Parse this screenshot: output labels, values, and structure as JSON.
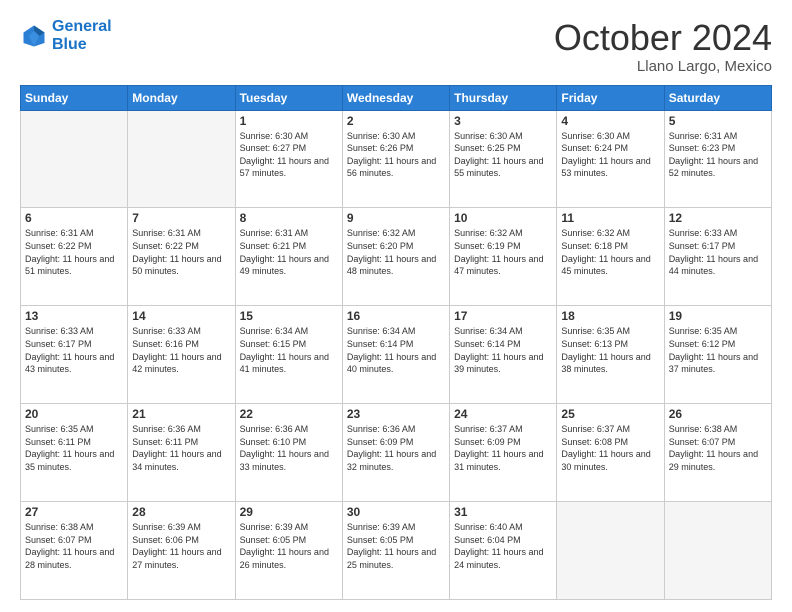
{
  "logo": {
    "line1": "General",
    "line2": "Blue"
  },
  "header": {
    "month": "October 2024",
    "location": "Llano Largo, Mexico"
  },
  "weekdays": [
    "Sunday",
    "Monday",
    "Tuesday",
    "Wednesday",
    "Thursday",
    "Friday",
    "Saturday"
  ],
  "weeks": [
    [
      {
        "day": "",
        "info": ""
      },
      {
        "day": "",
        "info": ""
      },
      {
        "day": "1",
        "info": "Sunrise: 6:30 AM\nSunset: 6:27 PM\nDaylight: 11 hours and 57 minutes."
      },
      {
        "day": "2",
        "info": "Sunrise: 6:30 AM\nSunset: 6:26 PM\nDaylight: 11 hours and 56 minutes."
      },
      {
        "day": "3",
        "info": "Sunrise: 6:30 AM\nSunset: 6:25 PM\nDaylight: 11 hours and 55 minutes."
      },
      {
        "day": "4",
        "info": "Sunrise: 6:30 AM\nSunset: 6:24 PM\nDaylight: 11 hours and 53 minutes."
      },
      {
        "day": "5",
        "info": "Sunrise: 6:31 AM\nSunset: 6:23 PM\nDaylight: 11 hours and 52 minutes."
      }
    ],
    [
      {
        "day": "6",
        "info": "Sunrise: 6:31 AM\nSunset: 6:22 PM\nDaylight: 11 hours and 51 minutes."
      },
      {
        "day": "7",
        "info": "Sunrise: 6:31 AM\nSunset: 6:22 PM\nDaylight: 11 hours and 50 minutes."
      },
      {
        "day": "8",
        "info": "Sunrise: 6:31 AM\nSunset: 6:21 PM\nDaylight: 11 hours and 49 minutes."
      },
      {
        "day": "9",
        "info": "Sunrise: 6:32 AM\nSunset: 6:20 PM\nDaylight: 11 hours and 48 minutes."
      },
      {
        "day": "10",
        "info": "Sunrise: 6:32 AM\nSunset: 6:19 PM\nDaylight: 11 hours and 47 minutes."
      },
      {
        "day": "11",
        "info": "Sunrise: 6:32 AM\nSunset: 6:18 PM\nDaylight: 11 hours and 45 minutes."
      },
      {
        "day": "12",
        "info": "Sunrise: 6:33 AM\nSunset: 6:17 PM\nDaylight: 11 hours and 44 minutes."
      }
    ],
    [
      {
        "day": "13",
        "info": "Sunrise: 6:33 AM\nSunset: 6:17 PM\nDaylight: 11 hours and 43 minutes."
      },
      {
        "day": "14",
        "info": "Sunrise: 6:33 AM\nSunset: 6:16 PM\nDaylight: 11 hours and 42 minutes."
      },
      {
        "day": "15",
        "info": "Sunrise: 6:34 AM\nSunset: 6:15 PM\nDaylight: 11 hours and 41 minutes."
      },
      {
        "day": "16",
        "info": "Sunrise: 6:34 AM\nSunset: 6:14 PM\nDaylight: 11 hours and 40 minutes."
      },
      {
        "day": "17",
        "info": "Sunrise: 6:34 AM\nSunset: 6:14 PM\nDaylight: 11 hours and 39 minutes."
      },
      {
        "day": "18",
        "info": "Sunrise: 6:35 AM\nSunset: 6:13 PM\nDaylight: 11 hours and 38 minutes."
      },
      {
        "day": "19",
        "info": "Sunrise: 6:35 AM\nSunset: 6:12 PM\nDaylight: 11 hours and 37 minutes."
      }
    ],
    [
      {
        "day": "20",
        "info": "Sunrise: 6:35 AM\nSunset: 6:11 PM\nDaylight: 11 hours and 35 minutes."
      },
      {
        "day": "21",
        "info": "Sunrise: 6:36 AM\nSunset: 6:11 PM\nDaylight: 11 hours and 34 minutes."
      },
      {
        "day": "22",
        "info": "Sunrise: 6:36 AM\nSunset: 6:10 PM\nDaylight: 11 hours and 33 minutes."
      },
      {
        "day": "23",
        "info": "Sunrise: 6:36 AM\nSunset: 6:09 PM\nDaylight: 11 hours and 32 minutes."
      },
      {
        "day": "24",
        "info": "Sunrise: 6:37 AM\nSunset: 6:09 PM\nDaylight: 11 hours and 31 minutes."
      },
      {
        "day": "25",
        "info": "Sunrise: 6:37 AM\nSunset: 6:08 PM\nDaylight: 11 hours and 30 minutes."
      },
      {
        "day": "26",
        "info": "Sunrise: 6:38 AM\nSunset: 6:07 PM\nDaylight: 11 hours and 29 minutes."
      }
    ],
    [
      {
        "day": "27",
        "info": "Sunrise: 6:38 AM\nSunset: 6:07 PM\nDaylight: 11 hours and 28 minutes."
      },
      {
        "day": "28",
        "info": "Sunrise: 6:39 AM\nSunset: 6:06 PM\nDaylight: 11 hours and 27 minutes."
      },
      {
        "day": "29",
        "info": "Sunrise: 6:39 AM\nSunset: 6:05 PM\nDaylight: 11 hours and 26 minutes."
      },
      {
        "day": "30",
        "info": "Sunrise: 6:39 AM\nSunset: 6:05 PM\nDaylight: 11 hours and 25 minutes."
      },
      {
        "day": "31",
        "info": "Sunrise: 6:40 AM\nSunset: 6:04 PM\nDaylight: 11 hours and 24 minutes."
      },
      {
        "day": "",
        "info": ""
      },
      {
        "day": "",
        "info": ""
      }
    ]
  ]
}
